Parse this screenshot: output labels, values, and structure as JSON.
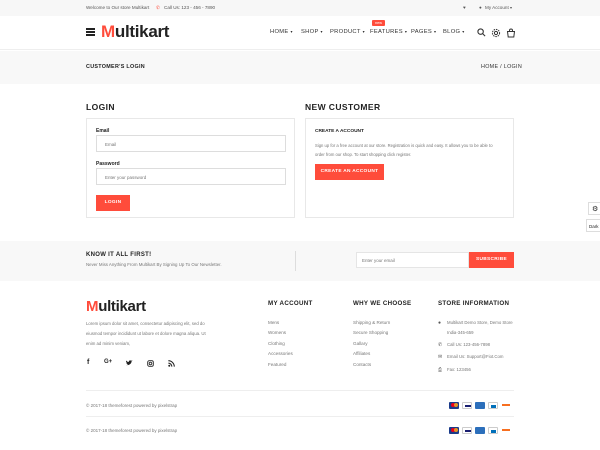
{
  "topbar": {
    "welcome": "Welcome to Our store Multikart",
    "phone": "Call Us: 123 - 456 - 7890",
    "account": "My Account"
  },
  "header": {
    "logo_accent": "M",
    "logo_rest": "ultikart",
    "nav": [
      "HOME",
      "SHOP",
      "PRODUCT",
      "FEATURES",
      "PAGES",
      "BLOG"
    ],
    "new_badge": "new"
  },
  "breadcrumb": {
    "title": "CUSTOMER'S LOGIN",
    "path": "HOME  /  LOGIN"
  },
  "login": {
    "title": "LOGIN",
    "email_label": "Email",
    "email_placeholder": "Email",
    "password_label": "Password",
    "password_placeholder": "Enter your password",
    "button": "LOGIN"
  },
  "new_customer": {
    "title": "NEW CUSTOMER",
    "subtitle": "CREATE A ACCOUNT",
    "text_line1": "Sign up for a free account at our store. Registration is quick and easy. It allows you to be able to",
    "text_line2": "order from our shop. To start shopping click register.",
    "button": "CREATE AN ACCOUNT"
  },
  "newsletter": {
    "title": "KNOW IT ALL FIRST!",
    "subtitle": "Never Miss Anything From Multikart By Signing Up To Our Newsletter.",
    "placeholder": "Enter your email",
    "button": "SUBSCRIBE"
  },
  "footer": {
    "about_line1": "Lorem ipsum dolor sit amet, consectetur adipiscing elit, sed do",
    "about_line2": "eiusmod tempor incididunt ut labore et dolore magna aliqua. Ut",
    "about_line3": "enim ad minim veniam,",
    "my_account": {
      "title": "MY ACCOUNT",
      "items": [
        "Mens",
        "Womens",
        "Clothing",
        "Accessories",
        "Featured"
      ]
    },
    "why_choose": {
      "title": "WHY WE CHOOSE",
      "items": [
        "Shipping & Return",
        "Secure Shopping",
        "Gallary",
        "Affiliates",
        "Contacts"
      ]
    },
    "store_info": {
      "title": "STORE INFORMATION",
      "address_line1": "Multikart Demo Store, Demo Store",
      "address_line2": "India-345-659",
      "phone": "Call Us: 123-456-7898",
      "email": "Email Us: Support@Fiot.Com",
      "fax": "Fax: 123456"
    },
    "copyright": "© 2017-18 themeforest powered by pixelstrap"
  },
  "side_tool": {
    "label": "Dark"
  },
  "colors": {
    "accent": "#ff4c3b",
    "band": "#f8f8f8"
  }
}
